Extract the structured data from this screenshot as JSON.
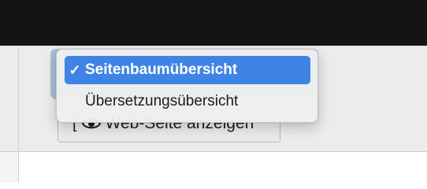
{
  "dropdown": {
    "items": [
      {
        "label": "Seitenbaumübersicht",
        "selected": true,
        "check": "✓"
      },
      {
        "label": "Übersetzungsübersicht",
        "selected": false
      }
    ]
  },
  "toolbar": {
    "view_button_label": "Web-Seite anzeigen"
  },
  "colors": {
    "highlight": "#3f84e5",
    "top_bar": "#141414"
  }
}
